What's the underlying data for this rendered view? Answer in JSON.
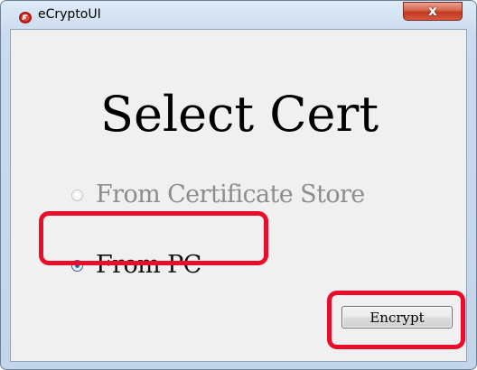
{
  "window": {
    "title": "eCryptoUI",
    "icon": "ecrypto-app-icon",
    "close_label": "x"
  },
  "main": {
    "heading": "Select Cert",
    "options": [
      {
        "label": "From Certificate Store",
        "selected": false,
        "enabled": false
      },
      {
        "label": "From PC",
        "selected": true,
        "enabled": true
      }
    ],
    "encrypt_label": "Encrypt"
  },
  "colors": {
    "highlight": "#ea0d2a",
    "close_button": "#c2381e",
    "window_frame": "#c3d5ea",
    "client_background": "#f0f0f0"
  }
}
